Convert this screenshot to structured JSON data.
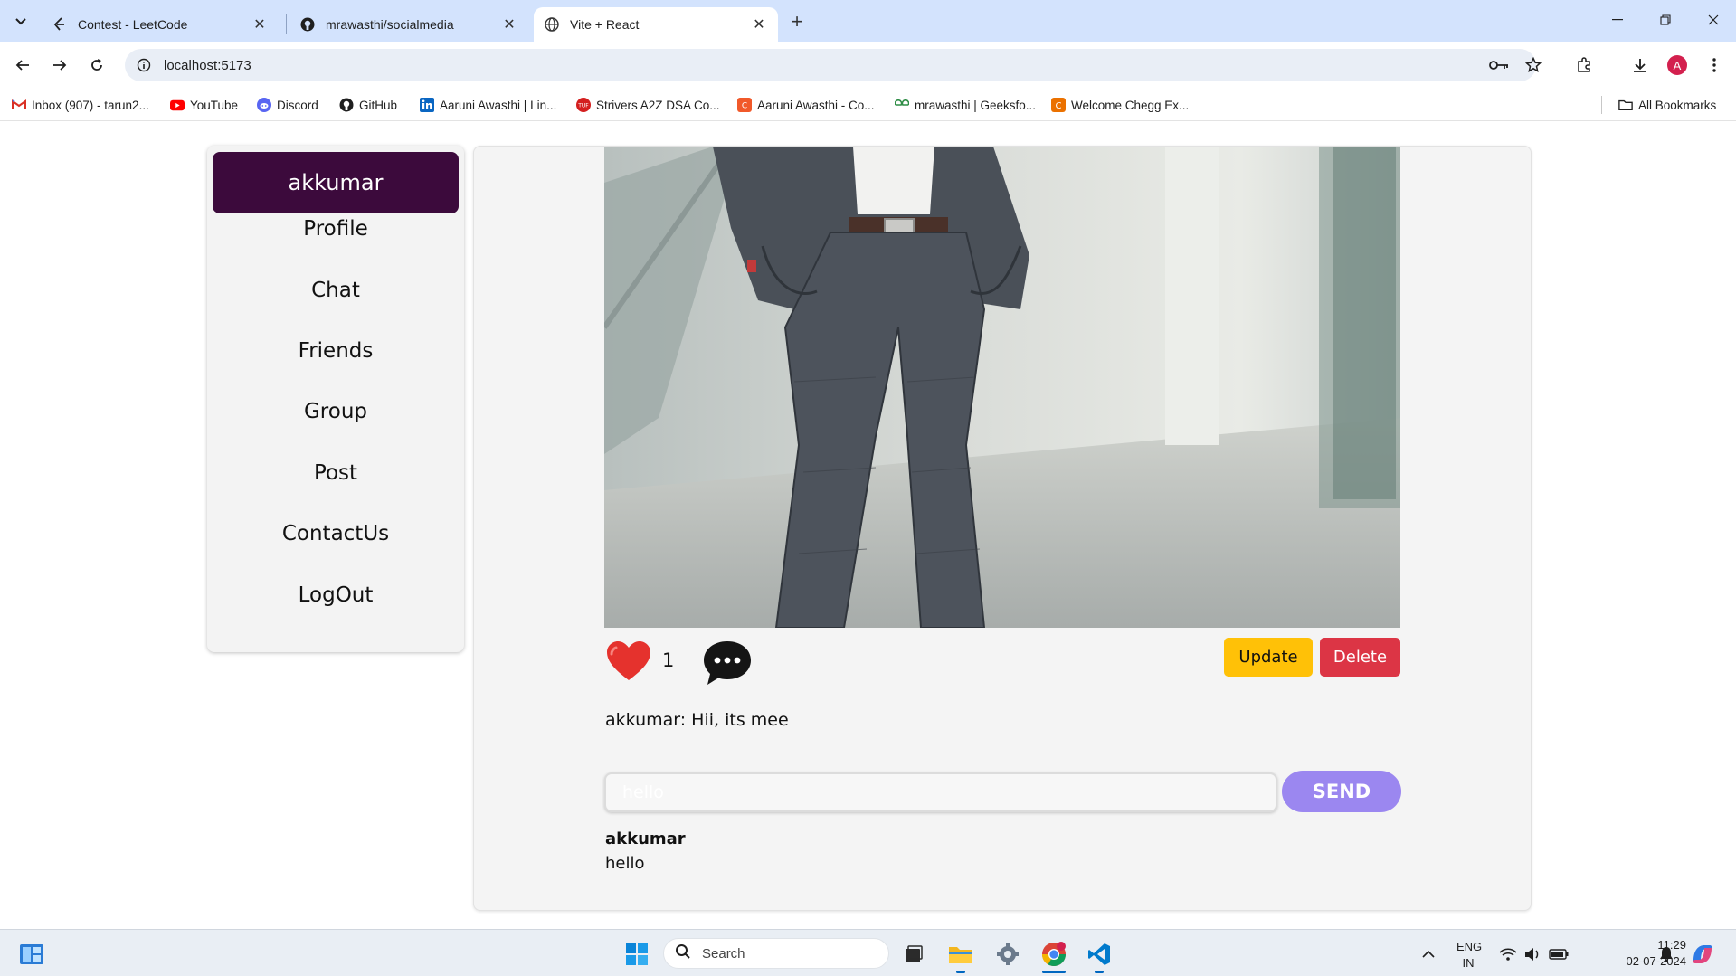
{
  "browser": {
    "tabs": [
      {
        "title": "Contest - LeetCode",
        "favicon": "leetcode-icon",
        "active": false
      },
      {
        "title": "mrawasthi/socialmedia",
        "favicon": "github-icon",
        "active": false
      },
      {
        "title": "Vite + React",
        "favicon": "globe-icon",
        "active": true
      }
    ],
    "new_tab_label": "+",
    "url": "localhost:5173",
    "bookmarks": [
      {
        "label": "Inbox (907) - tarun2...",
        "icon": "gmail-icon"
      },
      {
        "label": "YouTube",
        "icon": "youtube-icon"
      },
      {
        "label": "Discord",
        "icon": "discord-icon"
      },
      {
        "label": "GitHub",
        "icon": "github-icon"
      },
      {
        "label": "Aaruni Awasthi | Lin...",
        "icon": "linkedin-icon"
      },
      {
        "label": "Strivers A2Z DSA Co...",
        "icon": "tuf-icon"
      },
      {
        "label": "Aaruni Awasthi - Co...",
        "icon": "codechef-icon"
      },
      {
        "label": "mrawasthi | Geeksfo...",
        "icon": "geeksforgeeks-icon"
      },
      {
        "label": "Welcome Chegg Ex...",
        "icon": "chegg-icon"
      }
    ],
    "all_bookmarks_label": "All Bookmarks",
    "profile_initial": "A"
  },
  "sidebar": {
    "username": "akkumar",
    "items": [
      {
        "label": "Profile"
      },
      {
        "label": "Chat"
      },
      {
        "label": "Friends"
      },
      {
        "label": "Group"
      },
      {
        "label": "Post"
      },
      {
        "label": "ContactUs"
      },
      {
        "label": "LogOut"
      }
    ]
  },
  "post": {
    "likes": "1",
    "update_label": "Update",
    "delete_label": "Delete",
    "caption": "akkumar: Hii, its mee",
    "comment_input_placeholder": "hello",
    "send_label": "SEND",
    "comments": [
      {
        "author": "akkumar",
        "text": "hello"
      }
    ]
  },
  "colors": {
    "user_banner": "#3c0a3c",
    "update_button": "#ffc107",
    "delete_button": "#dc3545",
    "send_button": "#9b87f0",
    "like_heart": "#e5322d"
  },
  "taskbar": {
    "search_placeholder": "Search",
    "language": "ENG",
    "region": "IN",
    "time": "11:29",
    "date": "02-07-2024"
  }
}
